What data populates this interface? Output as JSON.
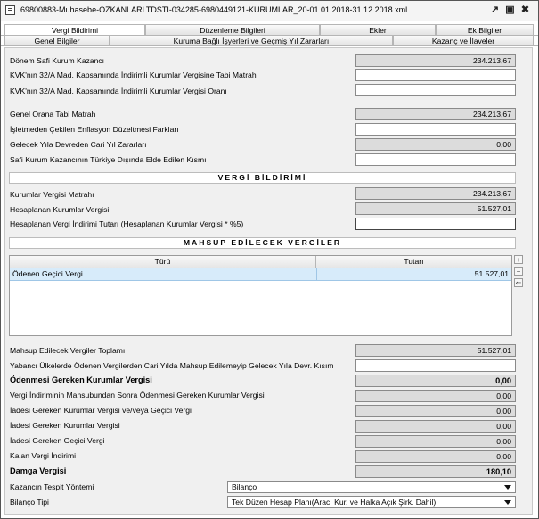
{
  "window": {
    "title": "69800883-Muhasebe-OZKANLARLTDSTI-034285-6980449121-KURUMLAR_20-01.01.2018-31.12.2018.xml"
  },
  "tabs_row1": [
    "Vergi Bildirimi",
    "Düzenleme Bilgileri",
    "Ekler",
    "Ek Bilgiler"
  ],
  "tabs_row2": [
    "Genel Bilgiler",
    "Kuruma Bağlı İşyerleri ve Geçmiş Yıl Zararları",
    "Kazanç ve İlaveler"
  ],
  "section1": [
    {
      "label": "Dönem Safi Kurum Kazancı",
      "value": "234.213,67",
      "readonly": true
    },
    {
      "label": "KVK'nın 32/A Mad. Kapsamında İndirimli Kurumlar Vergisine Tabi Matrah",
      "value": "",
      "readonly": false
    },
    {
      "label": "KVK'nın 32/A Mad. Kapsamında İndirimli Kurumlar Vergisi Oranı",
      "value": "",
      "readonly": false
    },
    {
      "label": "Genel Orana Tabi Matrah",
      "value": "234.213,67",
      "readonly": true
    },
    {
      "label": "İşletmeden Çekilen Enflasyon Düzeltmesi Farkları",
      "value": "",
      "readonly": false
    },
    {
      "label": "Gelecek Yıla Devreden Cari Yıl Zararları",
      "value": "0,00",
      "readonly": true
    },
    {
      "label": "Safi Kurum Kazancının Türkiye Dışında Elde Edilen Kısmı",
      "value": "",
      "readonly": false
    }
  ],
  "vergi_header": "VERGİ BİLDİRİMİ",
  "section2": [
    {
      "label": "Kurumlar Vergisi Matrahı",
      "value": "234.213,67",
      "readonly": true
    },
    {
      "label": "Hesaplanan Kurumlar Vergisi",
      "value": "51.527,01",
      "readonly": true
    },
    {
      "label": "Hesaplanan Vergi İndirimi Tutarı (Hesaplanan Kurumlar Vergisi * %5)",
      "value": "",
      "readonly": false
    }
  ],
  "mahsup_header": "MAHSUP EDİLECEK VERGİLER",
  "grid": {
    "columns": [
      "Türü",
      "Tutarı"
    ],
    "rows": [
      [
        "Ödenen Geçici Vergi",
        "51.527,01"
      ]
    ],
    "buttons": [
      "+",
      "−",
      "⇐"
    ]
  },
  "section3": [
    {
      "label": "Mahsup Edilecek Vergiler Toplamı",
      "value": "51.527,01",
      "readonly": true,
      "bold": false
    },
    {
      "label": "Yabancı Ülkelerde Ödenen Vergilerden Cari Yılda Mahsup Edilemeyip Gelecek Yıla Devr. Kısım",
      "value": "",
      "readonly": false,
      "bold": false
    },
    {
      "label": "Ödenmesi Gereken Kurumlar Vergisi",
      "value": "0,00",
      "readonly": true,
      "bold": true
    },
    {
      "label": "Vergi İndiriminin Mahsubundan Sonra Ödenmesi Gereken Kurumlar Vergisi",
      "value": "0,00",
      "readonly": true,
      "bold": false
    },
    {
      "label": "İadesi Gereken Kurumlar Vergisi ve/veya Geçici Vergi",
      "value": "0,00",
      "readonly": true,
      "bold": false
    },
    {
      "label": "İadesi Gereken Kurumlar Vergisi",
      "value": "0,00",
      "readonly": true,
      "bold": false
    },
    {
      "label": "İadesi Gereken Geçici Vergi",
      "value": "0,00",
      "readonly": true,
      "bold": false
    },
    {
      "label": "Kalan Vergi İndirimi",
      "value": "0,00",
      "readonly": true,
      "bold": false
    },
    {
      "label": "Damga Vergisi",
      "value": "180,10",
      "readonly": true,
      "bold": true
    }
  ],
  "selects": [
    {
      "label": "Kazancın Tespit Yöntemi",
      "value": "Bilanço"
    },
    {
      "label": "Bilanço Tipi",
      "value": "Tek Düzen Hesap Planı(Aracı Kur. ve Halka Açık Şirk. Dahil)"
    }
  ],
  "colors": {
    "readonly_bg": "#dcdcdc",
    "selected_row": "#d7ebfa",
    "panel_bg": "#f0f0f0"
  }
}
